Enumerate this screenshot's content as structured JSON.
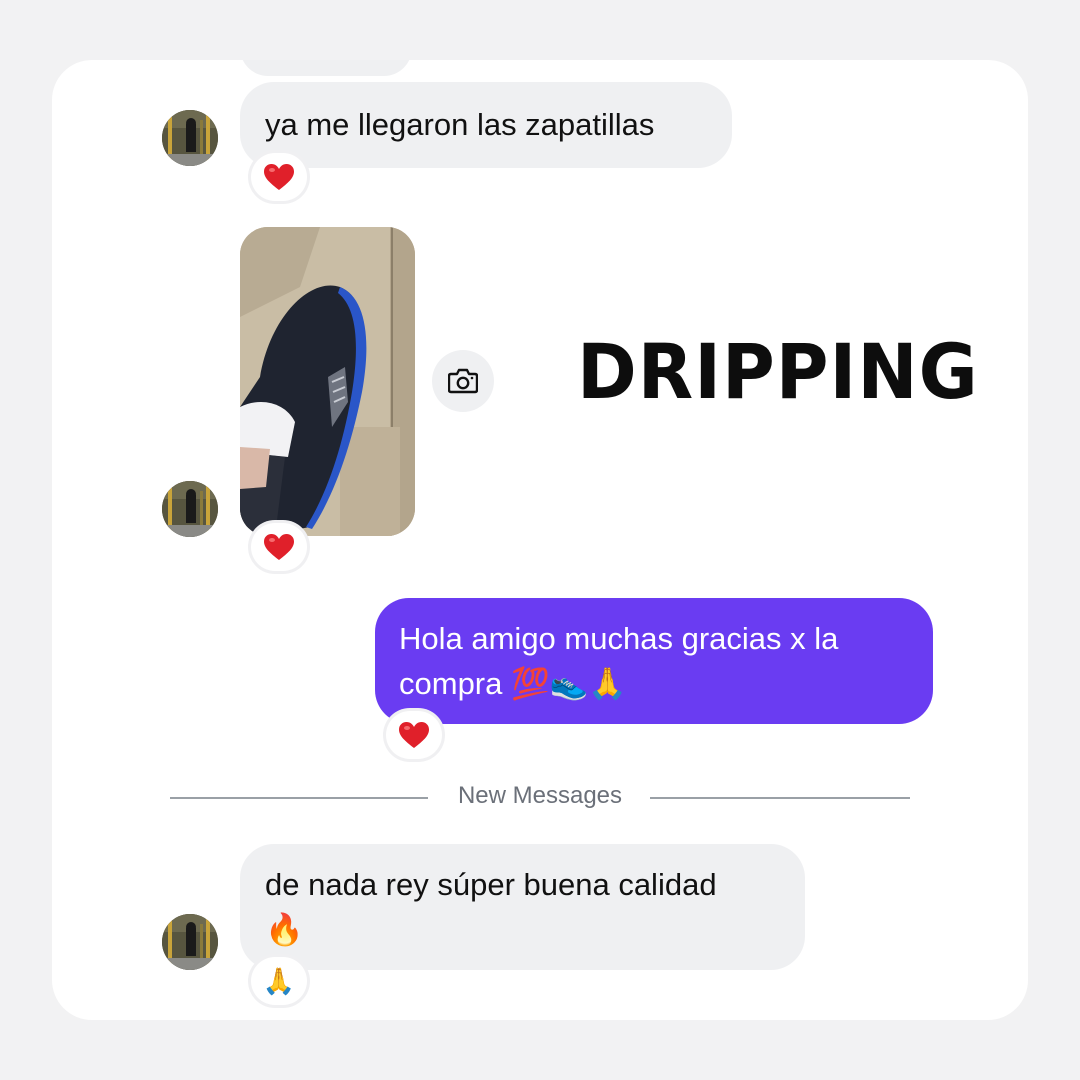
{
  "messages": {
    "msg1": {
      "text": "ya me llegaron las zapatillas",
      "reaction": "heart"
    },
    "msg2": {
      "type": "photo",
      "reaction": "heart"
    },
    "msg3": {
      "line1": "Hola amigo muchas gracias x la",
      "line2": "compra",
      "emoji": "💯👟🙏",
      "reaction": "heart"
    },
    "msg4": {
      "line1": "de nada rey súper buena calidad",
      "emoji": "🔥",
      "reaction": "🙏"
    }
  },
  "overlay": {
    "label": "DRIPPING"
  },
  "divider": {
    "label": "New Messages"
  },
  "icons": {
    "camera": "camera-icon",
    "heart": "heart-icon"
  },
  "colors": {
    "outgoing_bubble": "#6a3cf2",
    "incoming_bubble": "#eff0f2",
    "heart": "#e0202a"
  }
}
